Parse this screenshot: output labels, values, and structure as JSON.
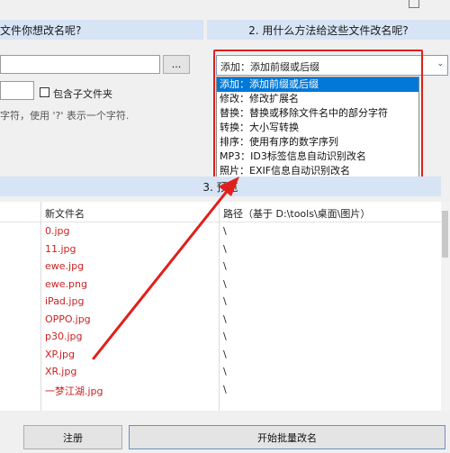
{
  "section1": {
    "title_partial": "文件你想改名呢?"
  },
  "section2": {
    "title": "2. 用什么方法给这些文件改名呢?"
  },
  "section3": {
    "title": "3. 预览"
  },
  "browse_button": {
    "label": "..."
  },
  "include_subfolders": {
    "label": "包含子文件夹",
    "checked": false
  },
  "wildcard_hint": {
    "text": "字符，使用 '?' 表示一个字符."
  },
  "method_select": {
    "selected": "添加：添加前缀或后缀",
    "options": [
      "添加：添加前缀或后缀",
      "修改：修改扩展名",
      "替换：替换或移除文件名中的部分字符",
      "转换：大小写转换",
      "排序：使用有序的数字序列",
      "MP3：ID3标签信息自动识别改名",
      "照片：EXIF信息自动识别改名"
    ]
  },
  "preview": {
    "columns": {
      "new_name": "新文件名",
      "path": "路径（基于 D:\\tools\\桌面\\图片）"
    },
    "rows": [
      {
        "new_name": "0.jpg",
        "path": "\\"
      },
      {
        "new_name": "11.jpg",
        "path": "\\"
      },
      {
        "new_name": "ewe.jpg",
        "path": "\\"
      },
      {
        "new_name": "ewe.png",
        "path": "\\"
      },
      {
        "new_name": "iPad.jpg",
        "path": "\\"
      },
      {
        "new_name": "OPPO.jpg",
        "path": "\\"
      },
      {
        "new_name": "p30.jpg",
        "path": "\\"
      },
      {
        "new_name": "XP.jpg",
        "path": "\\"
      },
      {
        "new_name": "XR.jpg",
        "path": "\\"
      },
      {
        "new_name": "一梦江湖.jpg",
        "path": "\\"
      }
    ]
  },
  "footer": {
    "register_label": "注册",
    "start_label": "开始批量改名"
  },
  "colors": {
    "header_bg": "#d6e4f5",
    "highlight_red": "#e0201b",
    "selection_blue": "#0078d7"
  }
}
